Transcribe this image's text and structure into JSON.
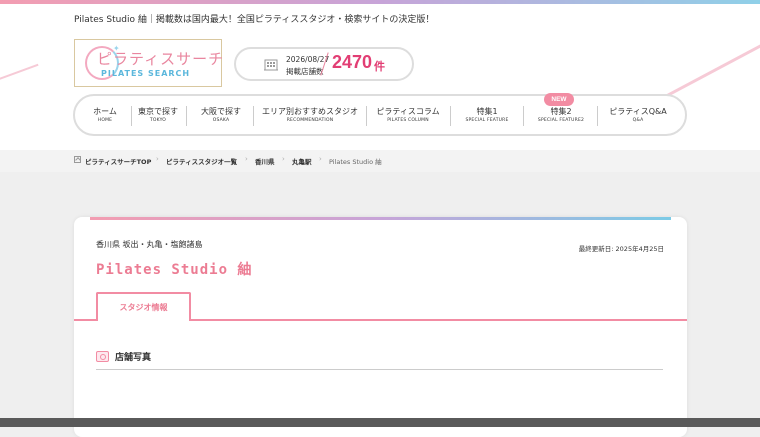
{
  "header": {
    "tagline": "Pilates Studio 紬｜掲載数は国内最大！全国ピラティススタジオ・検索サイトの決定版！",
    "logo_main": "ピラティスサーチ",
    "logo_sub": "PILATES SEARCH",
    "count_date": "2026/08/27",
    "count_label": "掲載店舗数",
    "count_value": "2470",
    "count_unit": "件"
  },
  "nav": {
    "items": [
      {
        "jp": "ホーム",
        "en": "HOME"
      },
      {
        "jp": "東京で探す",
        "en": "TOKYO"
      },
      {
        "jp": "大阪で探す",
        "en": "OSAKA"
      },
      {
        "jp": "エリア別おすすめスタジオ",
        "en": "RECOMMENDATION"
      },
      {
        "jp": "ピラティスコラム",
        "en": "PILATES COLUMN"
      },
      {
        "jp": "特集1",
        "en": "SPECIAL FEATURE"
      },
      {
        "jp": "特集2",
        "en": "SPECIAL FEATURE2"
      },
      {
        "jp": "ピラティスQ&A",
        "en": "Q&A"
      }
    ],
    "new_badge": "NEW"
  },
  "breadcrumb": [
    "ピラティスサーチTOP",
    "ピラティススタジオ一覧",
    "香川県",
    "丸亀駅",
    "Pilates Studio 紬"
  ],
  "studio": {
    "location": "香川県 坂出・丸亀・塩飽諸島",
    "updated": "最終更新日: 2025年4月25日",
    "name": "Pilates Studio 紬",
    "tab_label": "スタジオ情報",
    "section_title": "店舗写真"
  },
  "colors": {
    "accent": "#ec7c93",
    "count": "#e23e74",
    "tab_border": "#f28ca3"
  }
}
